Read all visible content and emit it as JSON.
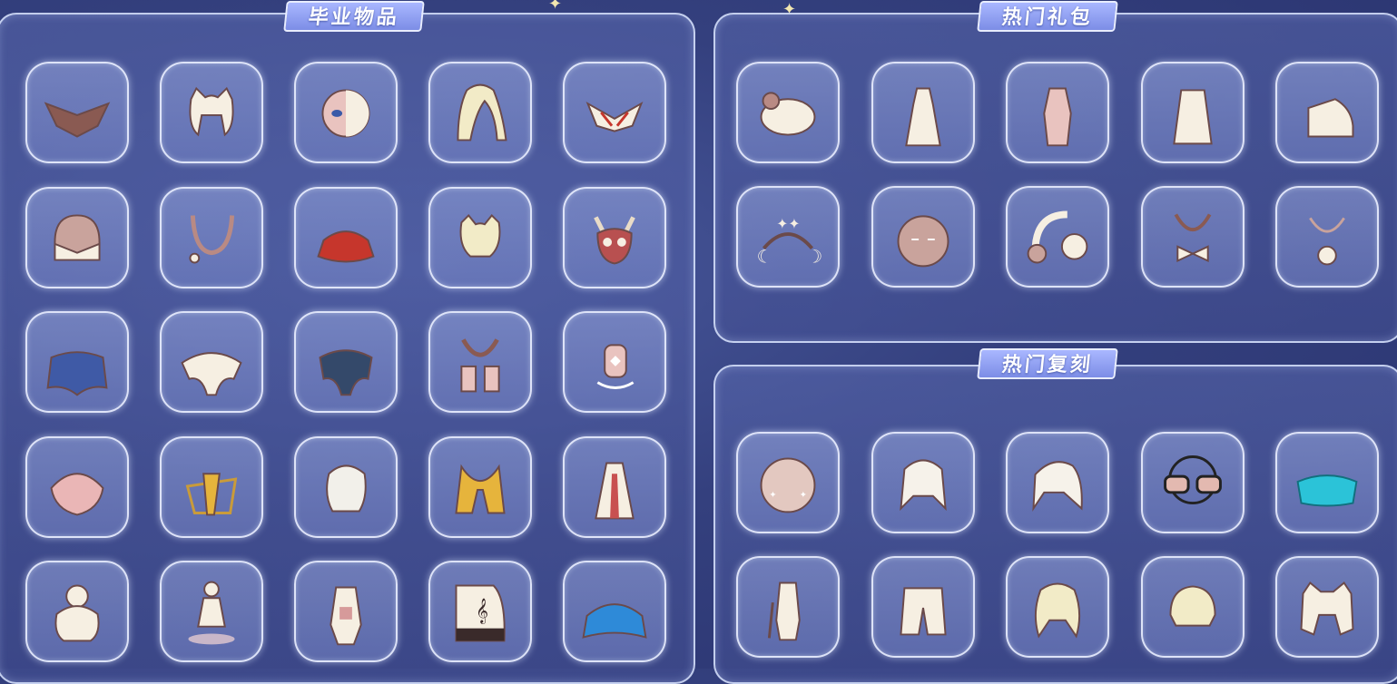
{
  "sections": {
    "graduation": {
      "title": "毕业物品"
    },
    "gift": {
      "title": "热门礼包"
    },
    "rerun": {
      "title": "热门复刻"
    }
  },
  "colors": {
    "panel_border": "#e6ecff",
    "tab_bg": "#8a9af0",
    "slot_border": "#ebf0ff",
    "item_cream": "#f6efe2",
    "item_pink": "#e9c3bf",
    "item_red": "#c6362c",
    "item_blue": "#3f5aa6",
    "item_gold": "#e6b43c",
    "item_cyan": "#2bc3d8"
  },
  "graduation_items": [
    "bat-mask-icon",
    "cat-ear-hair-icon",
    "half-mask-icon",
    "long-hair-icon",
    "antler-headdress-icon",
    "hood-mask-icon",
    "necklace-icon",
    "red-cape-icon",
    "horn-hair-icon",
    "owl-mask-icon",
    "blue-cape-icon",
    "white-cape-icon",
    "dark-cape-icon",
    "scarf-icon",
    "lantern-prop-icon",
    "shell-cape-icon",
    "gold-chain-cape-icon",
    "feather-hair-icon",
    "gold-scarf-icon",
    "robe-outfit-icon",
    "bun-hair-icon",
    "dancer-emote-icon",
    "armor-outfit-icon",
    "piano-prop-icon",
    "cyan-cape-icon"
  ],
  "gift_items": [
    "sheep-prop-icon",
    "dress-outfit-icon",
    "pink-outfit-icon",
    "white-cape-gift-icon",
    "shoes-icon",
    "star-moon-headband-icon",
    "round-mask-icon",
    "headphones-icon",
    "bow-necklace-icon",
    "flower-necklace-icon"
  ],
  "rerun_items": [
    "blush-mask-icon",
    "twin-tail-hair-icon",
    "ponytail-hair-icon",
    "sunglasses-icon",
    "cyan-cape-rerun-icon",
    "outfit-with-cane-icon",
    "pants-icon",
    "curly-hair-icon",
    "bob-hair-icon",
    "cat-ear-hair-rerun-icon"
  ]
}
